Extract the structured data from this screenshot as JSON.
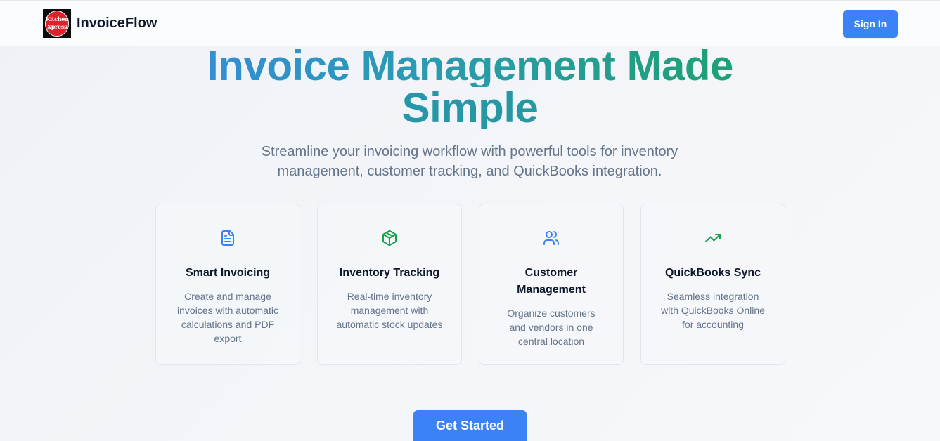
{
  "header": {
    "logo_text_line1": "Kitchen",
    "logo_text_line2": "Xpress",
    "brand_name": "InvoiceFlow",
    "sign_in_label": "Sign In"
  },
  "hero": {
    "title_line1": "Invoice Management Made",
    "title_line2": "Simple",
    "subtitle_line1": "Streamline your invoicing workflow with powerful tools for inventory",
    "subtitle_line2": "management, customer tracking, and QuickBooks integration."
  },
  "features": [
    {
      "icon": "document-icon",
      "title": "Smart Invoicing",
      "description": "Create and manage invoices with automatic calculations and PDF export"
    },
    {
      "icon": "package-icon",
      "title": "Inventory Tracking",
      "description": "Real-time inventory management with automatic stock updates"
    },
    {
      "icon": "users-icon",
      "title": "Customer Management",
      "description": "Organize customers and vendors in one central location"
    },
    {
      "icon": "trending-up-icon",
      "title": "QuickBooks Sync",
      "description": "Seamless integration with QuickBooks Online for accounting"
    }
  ],
  "cta": {
    "get_started_label": "Get Started"
  },
  "colors": {
    "primary": "#3b82f6",
    "green_accent": "#16a34a",
    "muted_text": "#64748b"
  }
}
